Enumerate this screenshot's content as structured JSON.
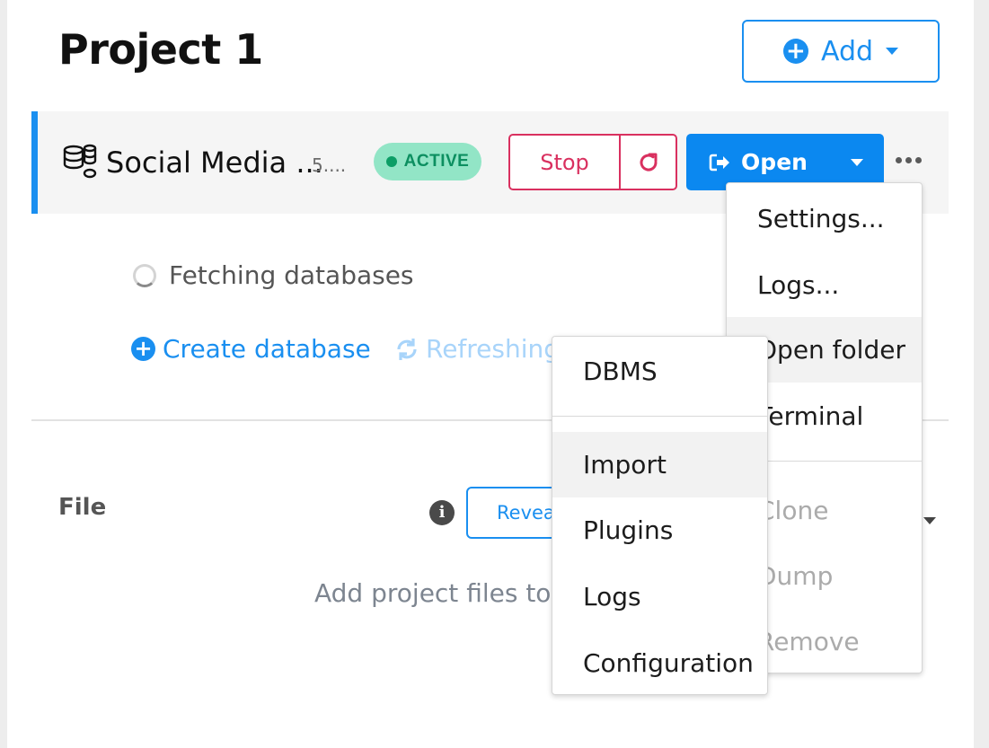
{
  "page": {
    "title": "Project 1",
    "add_label": "Add"
  },
  "dbms": {
    "name": "Social Media ...",
    "version": "5....",
    "status": "ACTIVE",
    "stop_label": "Stop",
    "open_label": "Open"
  },
  "databases": {
    "fetching_text": "Fetching databases",
    "create_label": "Create database",
    "refreshing_label": "Refreshing"
  },
  "files": {
    "section_label": "File",
    "reveal_label": "Reveal files in File Explorer",
    "empty_text": "Add project files to get started"
  },
  "open_menu": {
    "items": [
      "Settings...",
      "Logs...",
      "Open folder",
      "Terminal",
      "Clone",
      "Dump",
      "Remove"
    ],
    "highlighted": "Open folder",
    "disabled": [
      "Clone",
      "Dump",
      "Remove"
    ]
  },
  "folder_menu": {
    "items": [
      "DBMS",
      "Import",
      "Plugins",
      "Logs",
      "Configuration"
    ],
    "highlighted": "Import"
  },
  "colors": {
    "primary": "#1a8ff0",
    "danger": "#d9305f",
    "active_badge_bg": "#92e5c6",
    "active_badge_text": "#0c8f60"
  },
  "icons": [
    "plus-circle-icon",
    "chevron-down-icon",
    "database-icon",
    "restart-icon",
    "open-icon",
    "more-icon",
    "spinner-icon",
    "refresh-icon",
    "info-icon"
  ]
}
